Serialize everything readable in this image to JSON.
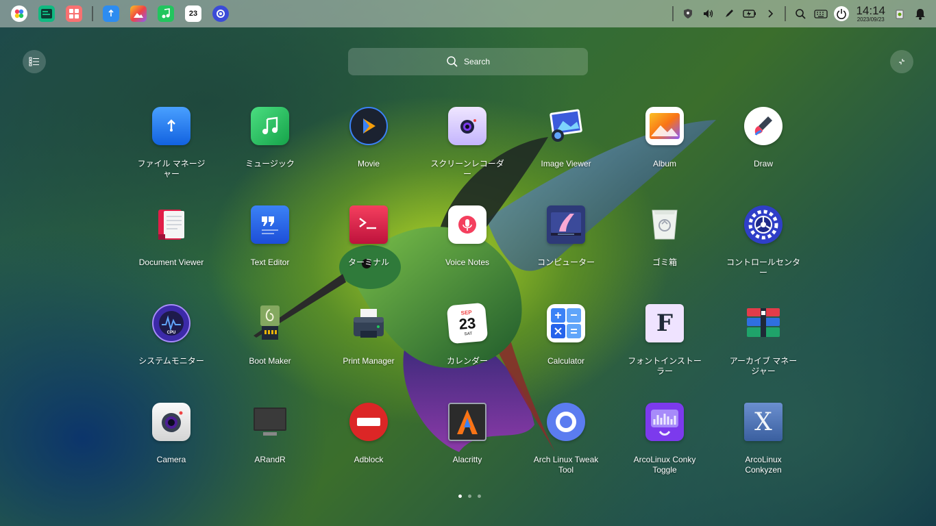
{
  "dock": {
    "apps": [
      {
        "name": "launcher",
        "color": "#ffffff"
      },
      {
        "name": "terminal-app",
        "color": "#10b981"
      },
      {
        "name": "multitasking",
        "color": "#f87171"
      },
      {
        "name": "file-manager",
        "color": "#2d8cf0"
      },
      {
        "name": "album",
        "color": "#f59e0b"
      },
      {
        "name": "music",
        "color": "#22c55e"
      },
      {
        "name": "calendar",
        "color": "#ffffff",
        "text": "23"
      },
      {
        "name": "control-center",
        "color": "#3b4bd8"
      }
    ],
    "clock": {
      "time": "14:14",
      "date": "2023/09/23"
    }
  },
  "search": {
    "placeholder": "Search"
  },
  "apps": [
    [
      {
        "label": "ファイル マネージャー",
        "icon": "folder-icon",
        "color": "#1e7cf2"
      },
      {
        "label": "ミュージック",
        "icon": "music-note-icon",
        "color": "#22c55e"
      },
      {
        "label": "Movie",
        "icon": "play-icon",
        "color": "#1f2937"
      },
      {
        "label": "スクリーンレコーダー",
        "icon": "camera-icon",
        "color": "#d8c8f0"
      },
      {
        "label": "Image Viewer",
        "icon": "image-icon",
        "color": "#4f7fe0"
      },
      {
        "label": "Album",
        "icon": "photo-icon",
        "color": "#f97316"
      },
      {
        "label": "Draw",
        "icon": "brush-icon",
        "color": "#ffffff"
      }
    ],
    [
      {
        "label": "Document Viewer",
        "icon": "book-icon",
        "color": "#e11d48"
      },
      {
        "label": "Text Editor",
        "icon": "quote-icon",
        "color": "#2563eb"
      },
      {
        "label": "ターミナル",
        "icon": "terminal-icon",
        "color": "#dc2646"
      },
      {
        "label": "Voice Notes",
        "icon": "microphone-icon",
        "color": "#ffffff"
      },
      {
        "label": "コンピューター",
        "icon": "monitor-icon",
        "color": "#3a4a8a"
      },
      {
        "label": "ゴミ箱",
        "icon": "trash-icon",
        "color": "#e8ece8"
      },
      {
        "label": "コントロールセンター",
        "icon": "gear-icon",
        "color": "#2f3fc8"
      }
    ],
    [
      {
        "label": "システムモニター",
        "icon": "cpu-icon",
        "color": "#3c2aa8"
      },
      {
        "label": "Boot Maker",
        "icon": "usb-icon",
        "color": "#1f2937"
      },
      {
        "label": "Print Manager",
        "icon": "printer-icon",
        "color": "#334155"
      },
      {
        "label": "カレンダー",
        "icon": "calendar-icon",
        "color": "#ffffff",
        "month": "SEP",
        "day": "23",
        "weekday": "SAT"
      },
      {
        "label": "Calculator",
        "icon": "calculator-icon",
        "color": "#2f8cf6"
      },
      {
        "label": "フォントインストーラー",
        "icon": "font-icon",
        "color": "#e9d5ff",
        "glyph": "F"
      },
      {
        "label": "アーカイブ マネージャー",
        "icon": "archive-icon",
        "color": "#e23c4a"
      }
    ],
    [
      {
        "label": "Camera",
        "icon": "camera-lens-icon",
        "color": "#f1f1f1"
      },
      {
        "label": "ARandR",
        "icon": "display-icon",
        "color": "#2b2b2b"
      },
      {
        "label": "Adblock",
        "icon": "block-icon",
        "color": "#dc2626"
      },
      {
        "label": "Alacritty",
        "icon": "alacritty-icon",
        "color": "#2b2b2b"
      },
      {
        "label": "Arch Linux Tweak Tool",
        "icon": "ring-icon",
        "color": "#5b7cf0"
      },
      {
        "label": "ArcoLinux Conky Toggle",
        "icon": "conky-icon",
        "color": "#7c3aed"
      },
      {
        "label": "ArcoLinux Conkyzen",
        "icon": "x-icon",
        "color": "#5a7fb8",
        "glyph": "X"
      }
    ]
  ]
}
